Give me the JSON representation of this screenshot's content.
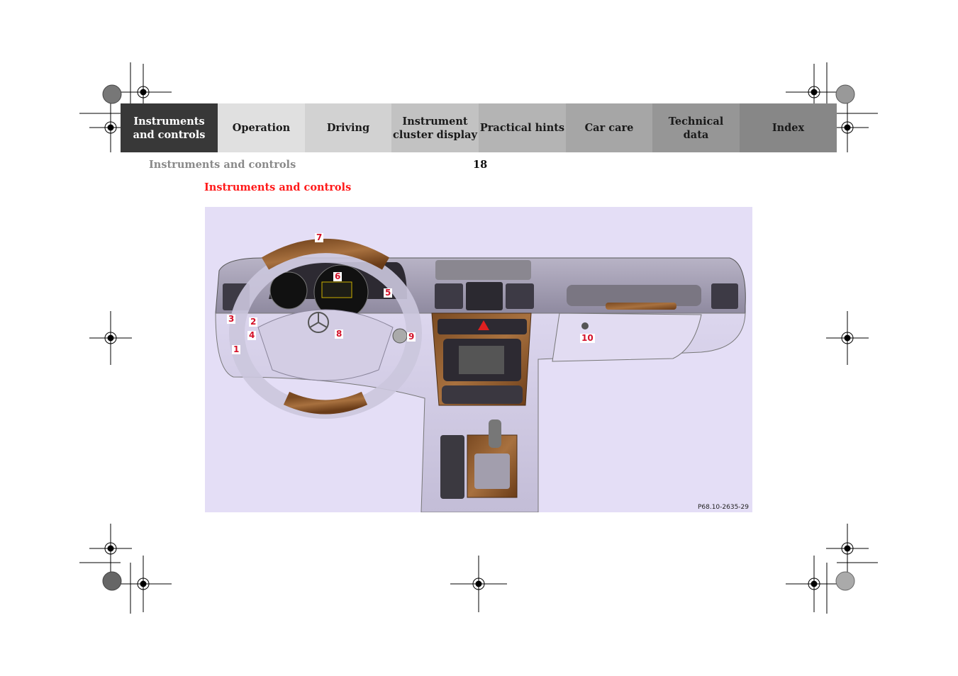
{
  "nav": {
    "tabs": [
      {
        "label": "Instruments\nand controls",
        "active": true,
        "color": "#383838"
      },
      {
        "label": "Operation",
        "active": false,
        "color": "#e0e0e0"
      },
      {
        "label": "Driving",
        "active": false,
        "color": "#d2d2d2"
      },
      {
        "label": "Instrument\ncluster display",
        "active": false,
        "color": "#c2c2c2"
      },
      {
        "label": "Practical hints",
        "active": false,
        "color": "#b4b4b4"
      },
      {
        "label": "Car care",
        "active": false,
        "color": "#a6a6a6"
      },
      {
        "label": "Technical\ndata",
        "active": false,
        "color": "#969696"
      },
      {
        "label": "Index",
        "active": false,
        "color": "#878787"
      }
    ]
  },
  "page": {
    "running_header": "Instruments and controls",
    "page_number": "18",
    "section_title": "Instruments and controls"
  },
  "figure": {
    "code": "P68.10-2635-29",
    "callouts": [
      "1",
      "2",
      "3",
      "4",
      "5",
      "6",
      "7",
      "8",
      "9",
      "10"
    ],
    "accent_color": "#d4122a",
    "background_color": "#e4def6"
  }
}
